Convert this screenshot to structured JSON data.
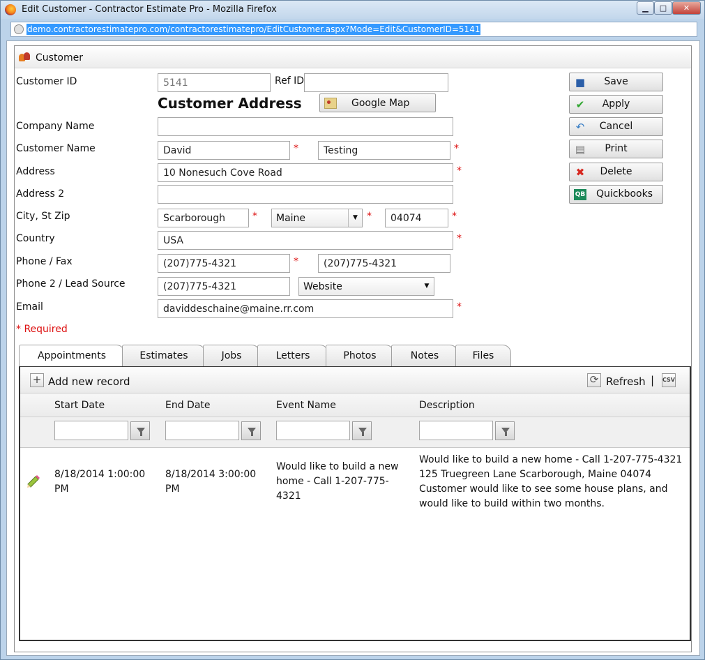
{
  "window": {
    "title": "Edit Customer - Contractor Estimate Pro - Mozilla Firefox",
    "url": "demo.contractorestimatepro.com/contractorestimatepro/EditCustomer.aspx?Mode=Edit&CustomerID=5141",
    "minimize_label": "▁",
    "maximize_label": "□",
    "close_label": "✕"
  },
  "panel": {
    "title": "Customer"
  },
  "form": {
    "customer_id_label": "Customer ID",
    "customer_id_value": "5141",
    "ref_id_label": "Ref ID",
    "ref_id_value": "",
    "address_title": "Customer Address",
    "google_map_label": "Google Map",
    "company_label": "Company Name",
    "company_value": "",
    "customer_name_label": "Customer Name",
    "first_name": "David",
    "last_name": "Testing",
    "address_label": "Address",
    "address_value": "10 Nonesuch Cove Road",
    "address2_label": "Address 2",
    "address2_value": "",
    "city_state_zip_label": "City, St Zip",
    "city": "Scarborough",
    "state": "Maine",
    "zip": "04074",
    "country_label": "Country",
    "country": "USA",
    "phone_fax_label": "Phone / Fax",
    "phone": "(207)775-4321",
    "fax": "(207)775-4321",
    "phone2_lead_label": "Phone 2 / Lead Source",
    "phone2": "(207)775-4321",
    "lead_source": "Website",
    "email_label": "Email",
    "email": "daviddeschaine@maine.rr.com",
    "required_marker": "*",
    "required_note": "* Required"
  },
  "actions": {
    "save": "Save",
    "apply": "Apply",
    "cancel": "Cancel",
    "print": "Print",
    "delete": "Delete",
    "quickbooks": "Quickbooks"
  },
  "tabs": [
    "Appointments",
    "Estimates",
    "Jobs",
    "Letters",
    "Photos",
    "Notes",
    "Files"
  ],
  "active_tab": "Appointments",
  "grid": {
    "add_label": "Add new record",
    "refresh_label": "Refresh",
    "separator": "|",
    "columns": [
      "Start Date",
      "End Date",
      "Event Name",
      "Description"
    ],
    "rows": [
      {
        "start": "8/18/2014 1:00:00 PM",
        "end": "8/18/2014 3:00:00 PM",
        "event": "Would like to build a new home - Call 1-207-775-4321",
        "description": "Would like to build a new home - Call 1-207-775-4321 125 Truegreen Lane Scarborough, Maine 04074 Customer would like to see some house plans, and would like to build within two months."
      }
    ]
  },
  "colors": {
    "required": "#dd1111",
    "url_highlight": "#3399ff",
    "title_bar": "#c3d7ec"
  }
}
